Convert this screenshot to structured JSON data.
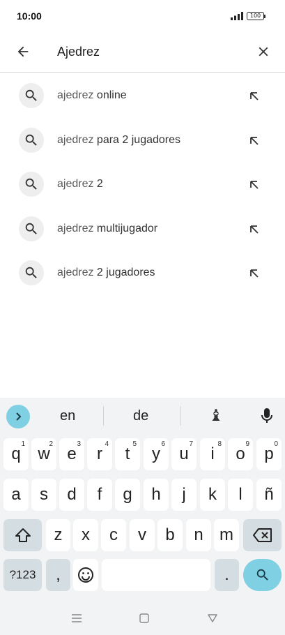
{
  "status_bar": {
    "time": "10:00",
    "battery": "100"
  },
  "search": {
    "query": "Ajedrez",
    "back_icon": "arrow-back-icon",
    "clear_icon": "close-icon"
  },
  "suggestions": [
    {
      "query": "ajedrez",
      "rest": " online"
    },
    {
      "query": "ajedrez",
      "rest": " para 2 jugadores"
    },
    {
      "query": "ajedrez",
      "rest": " 2"
    },
    {
      "query": "ajedrez",
      "rest": " multijugador"
    },
    {
      "query": "ajedrez",
      "rest": " 2 jugadores"
    }
  ],
  "keyboard": {
    "suggestions": [
      "en",
      "de"
    ],
    "emoji_suggestion": "♝",
    "row1": [
      {
        "key": "q",
        "sup": "1"
      },
      {
        "key": "w",
        "sup": "2"
      },
      {
        "key": "e",
        "sup": "3"
      },
      {
        "key": "r",
        "sup": "4"
      },
      {
        "key": "t",
        "sup": "5"
      },
      {
        "key": "y",
        "sup": "6"
      },
      {
        "key": "u",
        "sup": "7"
      },
      {
        "key": "i",
        "sup": "8"
      },
      {
        "key": "o",
        "sup": "9"
      },
      {
        "key": "p",
        "sup": "0"
      }
    ],
    "row2": [
      "a",
      "s",
      "d",
      "f",
      "g",
      "h",
      "j",
      "k",
      "l",
      "ñ"
    ],
    "row3": [
      "z",
      "x",
      "c",
      "v",
      "b",
      "n",
      "m"
    ],
    "symbols_label": "?123",
    "comma": ",",
    "period": ".",
    "emoji_icon": "☺"
  },
  "colors": {
    "accent": "#7fd0e3",
    "keyboard_bg": "#f2f3f4",
    "special_key": "#d4dde1"
  }
}
